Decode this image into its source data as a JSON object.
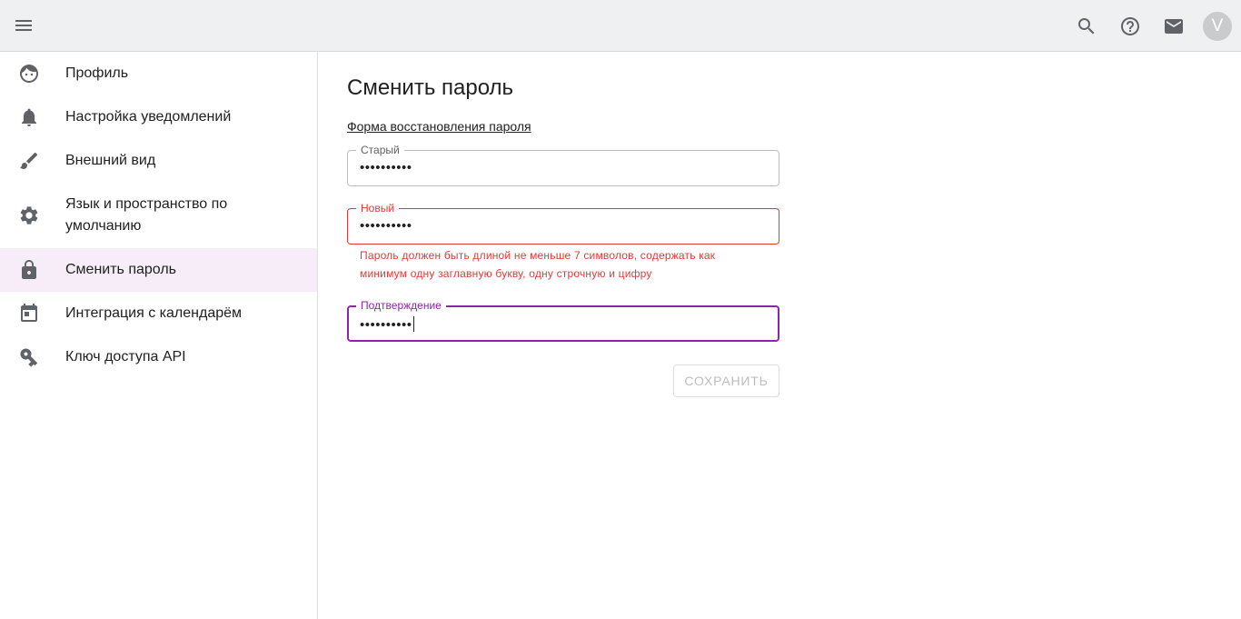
{
  "header": {
    "menu_icon": "menu-icon",
    "actions": [
      "search-icon",
      "help-icon",
      "mail-icon"
    ],
    "avatar_letter": "V"
  },
  "sidebar": {
    "items": [
      {
        "label": "Профиль",
        "icon": "face-icon"
      },
      {
        "label": "Настройка уведомлений",
        "icon": "bell-icon"
      },
      {
        "label": "Внешний вид",
        "icon": "brush-icon"
      },
      {
        "label": "Язык и пространство по умолчанию",
        "icon": "gear-icon"
      },
      {
        "label": "Сменить пароль",
        "icon": "lock-icon",
        "active": true
      },
      {
        "label": "Интеграция с календарём",
        "icon": "calendar-icon"
      },
      {
        "label": "Ключ доступа API",
        "icon": "key-icon"
      }
    ]
  },
  "main": {
    "title": "Сменить пароль",
    "reset_link": "Форма восстановления пароля",
    "fields": {
      "old": {
        "label": "Старый",
        "value": "••••••••••"
      },
      "new": {
        "label": "Новый",
        "value": "••••••••••",
        "error": "Пароль должен быть длиной не меньше 7 символов, содержать как минимум одну заглавную букву, одну строчную и цифру"
      },
      "confirm": {
        "label": "Подтверждение",
        "value": "••••••••••"
      }
    },
    "save_label": "СОХРАНИТЬ"
  },
  "colors": {
    "accent": "#8e24aa",
    "error": "#e53935",
    "active_bg": "#f6edf8",
    "topbar_bg": "#eef0f1"
  }
}
